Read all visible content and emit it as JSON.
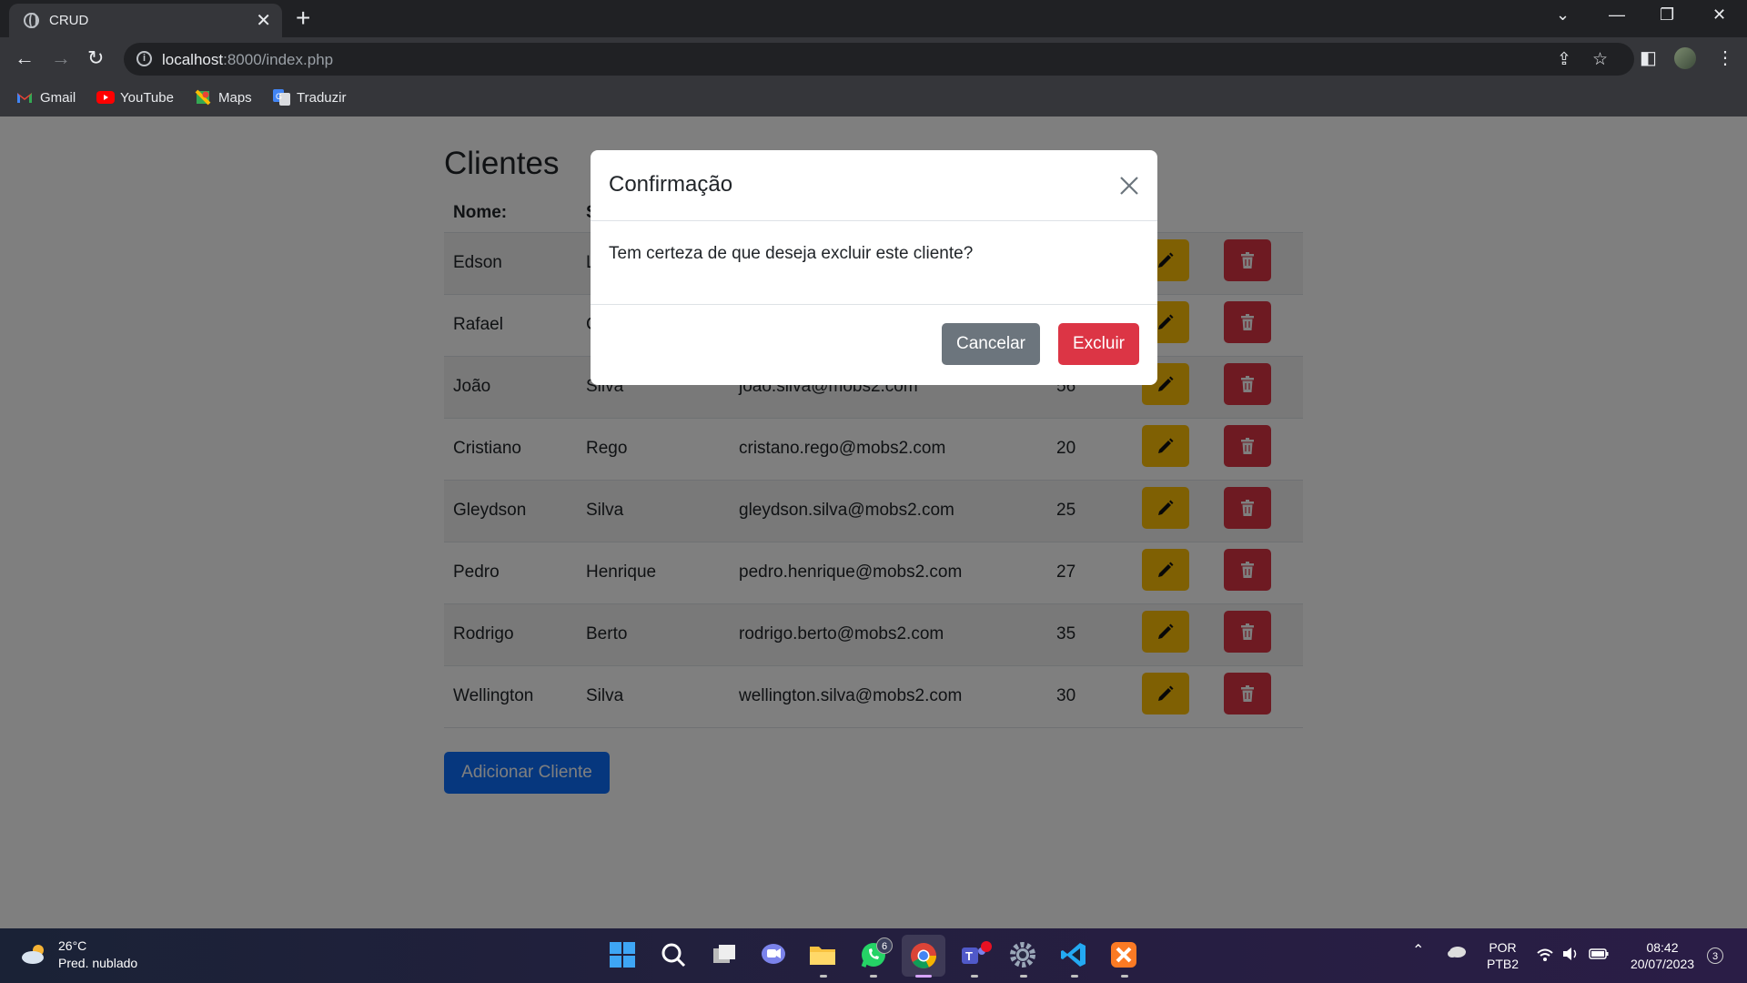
{
  "browser": {
    "tab_title": "CRUD",
    "url_host": "localhost",
    "url_path": ":8000/index.php",
    "bookmarks": [
      "Gmail",
      "YouTube",
      "Maps",
      "Traduzir"
    ]
  },
  "page": {
    "title": "Clientes",
    "columns": [
      "Nome:",
      "S"
    ],
    "rows": [
      {
        "nome": "Edson",
        "sobrenome": "L",
        "email": "",
        "idade": ""
      },
      {
        "nome": "Rafael",
        "sobrenome": "C",
        "email": "",
        "idade": ""
      },
      {
        "nome": "João",
        "sobrenome": "Silva",
        "email": "joao.silva@mobs2.com",
        "idade": "56"
      },
      {
        "nome": "Cristiano",
        "sobrenome": "Rego",
        "email": "cristano.rego@mobs2.com",
        "idade": "20"
      },
      {
        "nome": "Gleydson",
        "sobrenome": "Silva",
        "email": "gleydson.silva@mobs2.com",
        "idade": "25"
      },
      {
        "nome": "Pedro",
        "sobrenome": "Henrique",
        "email": "pedro.henrique@mobs2.com",
        "idade": "27"
      },
      {
        "nome": "Rodrigo",
        "sobrenome": "Berto",
        "email": "rodrigo.berto@mobs2.com",
        "idade": "35"
      },
      {
        "nome": "Wellington",
        "sobrenome": "Silva",
        "email": "wellington.silva@mobs2.com",
        "idade": "30"
      }
    ],
    "add_button": "Adicionar Cliente"
  },
  "modal": {
    "title": "Confirmação",
    "message": "Tem certeza de que deseja excluir este cliente?",
    "cancel_label": "Cancelar",
    "confirm_label": "Excluir"
  },
  "taskbar": {
    "temperature": "26°C",
    "weather": "Pred. nublado",
    "whatsapp_badge": "6",
    "lang_top": "POR",
    "lang_bottom": "PTB2",
    "time": "08:42",
    "date": "20/07/2023",
    "notification_count": "3"
  },
  "colors": {
    "edit": "#ffc107",
    "delete": "#dc3545",
    "primary": "#0d6efd",
    "secondary": "#6c757d"
  }
}
